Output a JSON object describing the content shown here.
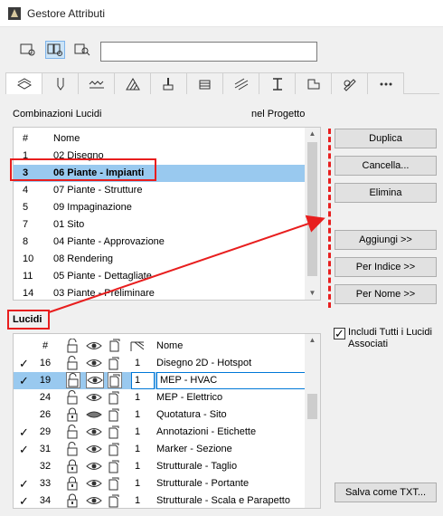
{
  "window": {
    "title": "Gestore Attributi"
  },
  "search": {
    "value": ""
  },
  "section": {
    "left_title": "Combinazioni Lucidi",
    "right_title": "nel Progetto"
  },
  "combos": {
    "headers": {
      "num": "#",
      "name": "Nome"
    },
    "rows": [
      {
        "num": "1",
        "name": "02 Disegno"
      },
      {
        "num": "3",
        "name": "06 Piante - Impianti",
        "selected": true
      },
      {
        "num": "4",
        "name": "07 Piante - Strutture"
      },
      {
        "num": "5",
        "name": "09 Impaginazione"
      },
      {
        "num": "7",
        "name": "01 Sito"
      },
      {
        "num": "8",
        "name": "04 Piante - Approvazione"
      },
      {
        "num": "10",
        "name": "08 Rendering"
      },
      {
        "num": "11",
        "name": "05 Piante - Dettagliate"
      },
      {
        "num": "14",
        "name": "03 Piante - Preliminare"
      }
    ]
  },
  "buttons": {
    "duplica": "Duplica",
    "cancella": "Cancella...",
    "elimina": "Elimina",
    "aggiungi": "Aggiungi >>",
    "per_indice": "Per Indice >>",
    "per_nome": "Per Nome >>",
    "salva": "Salva come TXT..."
  },
  "lucidi": {
    "title": "Lucidi",
    "headers": {
      "num": "#",
      "name": "Nome"
    },
    "include_all_label": "Includi Tutti i Lucidi Associati",
    "include_all_checked": true,
    "rows": [
      {
        "check": true,
        "num": "16",
        "lock": "open",
        "eye": "open",
        "pen": "1",
        "name": "Disegno 2D - Hotspot"
      },
      {
        "check": true,
        "num": "19",
        "lock": "open",
        "eye": "open",
        "pen": "1",
        "name": "MEP - HVAC",
        "selected": true
      },
      {
        "check": false,
        "num": "24",
        "lock": "open",
        "eye": "open",
        "pen": "1",
        "name": "MEP - Elettrico"
      },
      {
        "check": false,
        "num": "26",
        "lock": "closed",
        "eye": "closed",
        "pen": "1",
        "name": "Quotatura - Sito"
      },
      {
        "check": true,
        "num": "29",
        "lock": "open",
        "eye": "open",
        "pen": "1",
        "name": "Annotazioni - Etichette"
      },
      {
        "check": true,
        "num": "31",
        "lock": "open",
        "eye": "open",
        "pen": "1",
        "name": "Marker - Sezione"
      },
      {
        "check": false,
        "num": "32",
        "lock": "closed",
        "eye": "open",
        "pen": "1",
        "name": "Strutturale - Taglio"
      },
      {
        "check": true,
        "num": "33",
        "lock": "closed",
        "eye": "open",
        "pen": "1",
        "name": "Strutturale - Portante"
      },
      {
        "check": true,
        "num": "34",
        "lock": "closed",
        "eye": "open",
        "pen": "1",
        "name": "Strutturale - Scala e Parapetto"
      }
    ]
  }
}
